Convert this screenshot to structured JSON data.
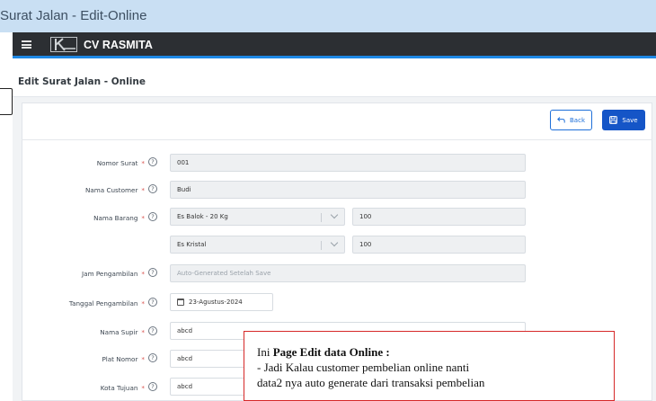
{
  "window": {
    "title": "Surat Jalan - Edit-Online"
  },
  "appbar": {
    "brand": "CV RASMITA"
  },
  "page": {
    "title": "Edit Surat Jalan - Online"
  },
  "toolbar": {
    "back_label": "Back",
    "save_label": "Save"
  },
  "form": {
    "nomor_surat": {
      "label": "Nomor Surat",
      "value": "001"
    },
    "nama_customer": {
      "label": "Nama Customer",
      "value": "Budi"
    },
    "nama_barang": {
      "label": "Nama Barang",
      "items": [
        {
          "item": "Es Balok - 20 Kg",
          "qty": "100"
        },
        {
          "item": "Es Kristal",
          "qty": "100"
        }
      ]
    },
    "jam_pengambilan": {
      "label": "Jam Pengambilan",
      "placeholder": "Auto-Generated Setelah Save"
    },
    "tanggal_pengambilan": {
      "label": "Tanggal Pengambilan",
      "value": "23-Agustus-2024"
    },
    "nama_supir": {
      "label": "Nama Supir",
      "value": "abcd"
    },
    "plat_nomor": {
      "label": "Plat Nomor",
      "value": "abcd"
    },
    "kota_tujuan": {
      "label": "Kota Tujuan",
      "value": "abcd"
    },
    "required_mark": "*",
    "help_mark": "?"
  },
  "note": {
    "prefix": "Ini ",
    "bold": "Page Edit data Online :",
    "line2": "- Jadi Kalau customer pembelian online nanti",
    "line3": "data2 nya auto generate dari transaksi pembelian"
  },
  "colors": {
    "accent": "#1555c7",
    "appbar": "#2c2f33",
    "titlebar": "#c9dff3",
    "note_border": "#d62828"
  }
}
